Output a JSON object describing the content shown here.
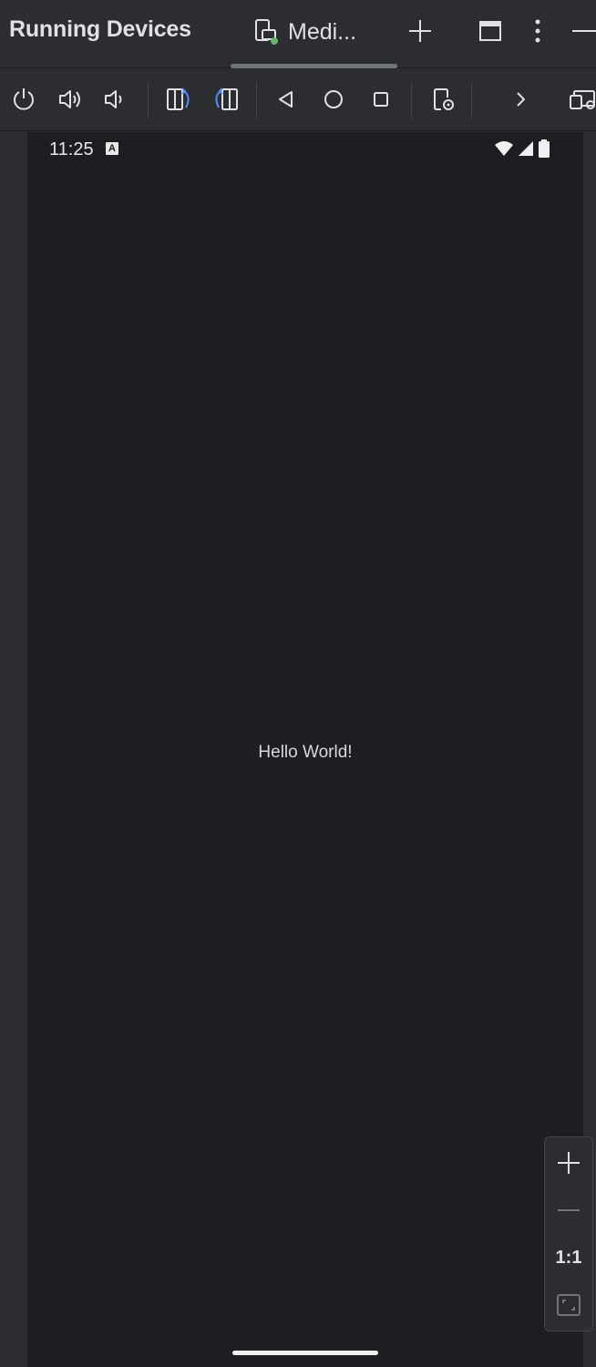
{
  "header": {
    "title": "Running Devices",
    "tab_label": "Medi...",
    "tab_icon": "device-mirror-icon",
    "actions": [
      "add-icon",
      "maximize-icon",
      "more-icon",
      "minimize-icon"
    ]
  },
  "toolbar": {
    "items": [
      "power-icon",
      "volume-up-icon",
      "volume-down-icon",
      "rotate-left-icon",
      "rotate-right-icon",
      "back-icon",
      "home-icon",
      "overview-icon",
      "device-settings-icon",
      "chevron-right-icon",
      "mirror-window-icon"
    ]
  },
  "device": {
    "status_time": "11:25",
    "status_badge": "A",
    "content_text": "Hello World!"
  },
  "zoom": {
    "actual_size_label": "1:1"
  },
  "colors": {
    "background": "#2b2d30",
    "screen": "#1e1e22",
    "accent_blue": "#548af7",
    "accent_green": "#5fb865"
  }
}
